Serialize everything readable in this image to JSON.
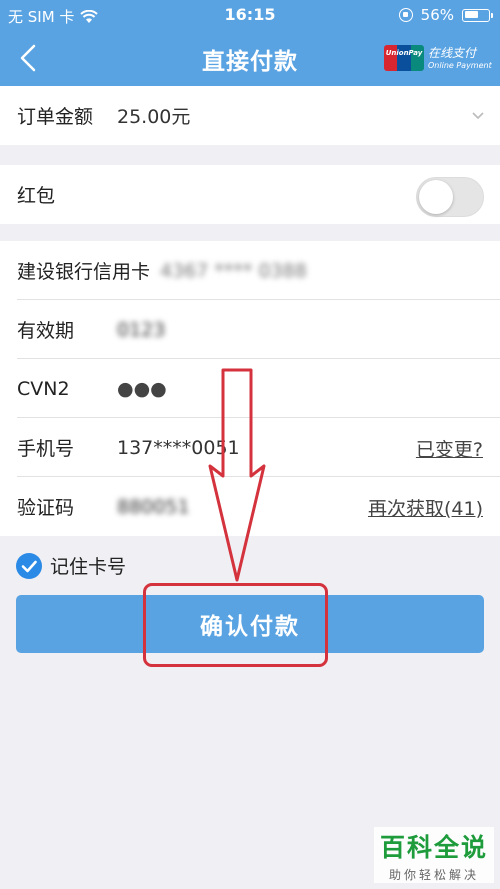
{
  "status_bar": {
    "carrier": "无 SIM 卡",
    "time": "16:15",
    "battery": "56%"
  },
  "nav": {
    "title": "直接付款",
    "brand_top": "在线支付",
    "brand_bottom": "Online Payment",
    "logo_text": "UnionPay"
  },
  "order": {
    "label": "订单金额",
    "amount": "25.00元"
  },
  "red_packet": {
    "label": "红包",
    "enabled": false
  },
  "card": {
    "bank_name": "建设银行信用卡",
    "card_number": "4367 **** 0388",
    "expiry_label": "有效期",
    "expiry_value": "0123",
    "cvn_label": "CVN2",
    "cvn_value": "●●●",
    "phone_label": "手机号",
    "phone_value": "137****0051",
    "phone_link": "已变更?",
    "code_label": "验证码",
    "code_value": "880051",
    "code_link": "再次获取(41)"
  },
  "remember": {
    "label": "记住卡号",
    "checked": true
  },
  "confirm_button": "确认付款",
  "watermark": {
    "title": "百科全说",
    "subtitle": "助你轻松解决"
  },
  "colors": {
    "brand_blue": "#5aa3e2",
    "annotation_red": "#d4323c",
    "watermark_green": "#1e9c3c"
  }
}
